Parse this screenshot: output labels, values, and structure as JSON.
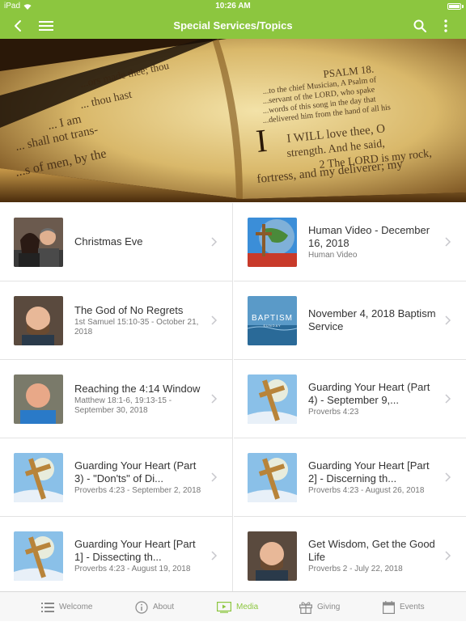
{
  "status_bar": {
    "device": "iPad",
    "time": "10:26 AM"
  },
  "nav": {
    "title": "Special Services/Topics"
  },
  "hero": {
    "left_lines": [
      "...ors made thee; thou",
      "... thou hast",
      "... I am",
      "... shall not trans-",
      "...s of men, by the"
    ],
    "right_lines": [
      "PSALM 18.",
      "...to the chief Musician, A Psalm of",
      "...servant of the LORD, who spake",
      "...words of this song in the day that",
      "...delivered him from the hand of all his",
      "I WILL love thee, O",
      "strength. And he said,",
      "2 The LORD is my rock,",
      "fortress, and my deliverer; my"
    ]
  },
  "items": [
    {
      "title": "Christmas Eve",
      "subtitle": "",
      "thumb": "couple-photo"
    },
    {
      "title": "Human Video - December 16, 2018",
      "subtitle": "Human Video",
      "thumb": "cross-globe"
    },
    {
      "title": "The God of No Regrets",
      "subtitle": "1st Samuel 15:10-35 - October 21, 2018",
      "thumb": "man-bald"
    },
    {
      "title": "November 4, 2018 Baptism Service",
      "subtitle": "",
      "thumb": "baptism"
    },
    {
      "title": "Reaching the 4:14 Window",
      "subtitle": "Matthew 18:1-6, 19:13-15 - September 30, 2018",
      "thumb": "man-blue"
    },
    {
      "title": "Guarding Your Heart (Part 4) - September 9,...",
      "subtitle": "Proverbs 4:23",
      "thumb": "cross-sky"
    },
    {
      "title": "Guarding Your Heart (Part 3) - \"Don'ts\" of Di...",
      "subtitle": "Proverbs 4:23 - September 2, 2018",
      "thumb": "cross-sky"
    },
    {
      "title": "Guarding Your Heart [Part 2] - Discerning th...",
      "subtitle": "Proverbs 4:23 - August 26, 2018",
      "thumb": "cross-sky"
    },
    {
      "title": "Guarding Your Heart [Part 1] - Dissecting th...",
      "subtitle": "Proverbs 4:23 - August 19, 2018",
      "thumb": "cross-sky"
    },
    {
      "title": "Get Wisdom, Get the Good Life",
      "subtitle": "Proverbs 2 - July 22, 2018",
      "thumb": "man-bald"
    }
  ],
  "baptism_text": {
    "main": "BAPTISM",
    "sub": "SUNDAY"
  },
  "tabs": [
    {
      "label": "Welcome",
      "icon": "list-icon",
      "active": false
    },
    {
      "label": "About",
      "icon": "info-icon",
      "active": false
    },
    {
      "label": "Media",
      "icon": "play-icon",
      "active": true
    },
    {
      "label": "Giving",
      "icon": "gift-icon",
      "active": false
    },
    {
      "label": "Events",
      "icon": "calendar-icon",
      "active": false
    }
  ],
  "colors": {
    "accent": "#8cc63f",
    "divider": "#e3e3e3",
    "tab_inactive": "#8a8a8a"
  }
}
